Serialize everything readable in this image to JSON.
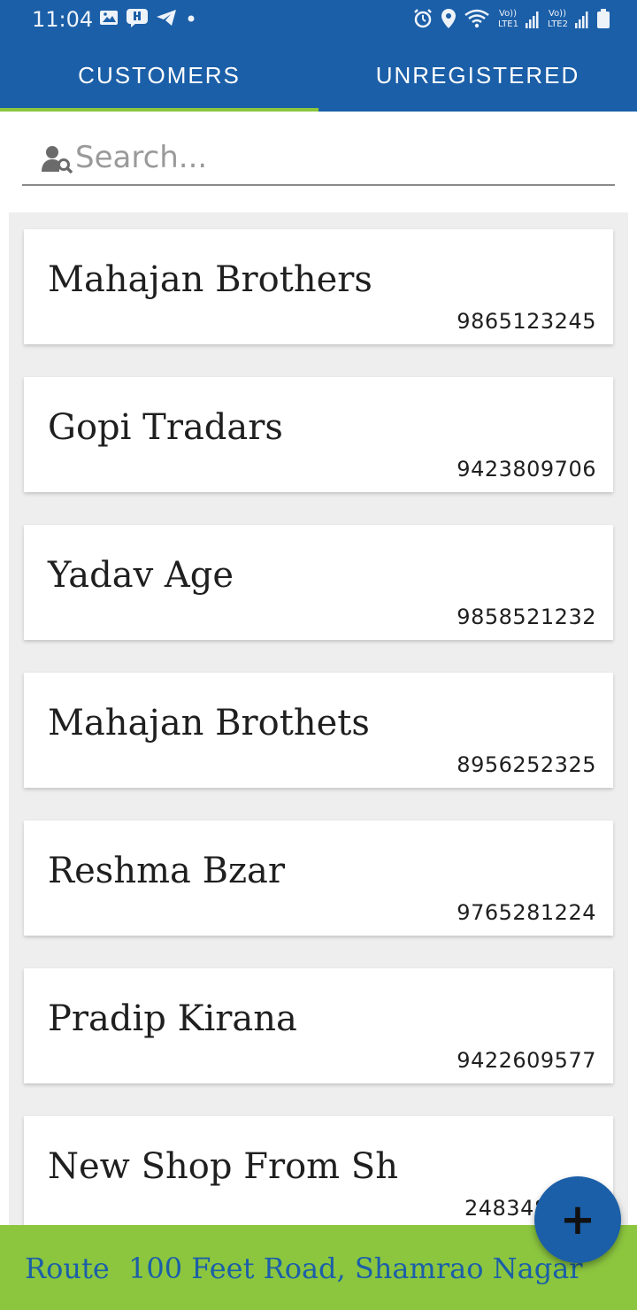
{
  "status_bar": {
    "time": "11:04",
    "left_icons": [
      "gallery-icon",
      "messaging-icon",
      "telegram-icon",
      "dot-icon"
    ],
    "right_icons": [
      "alarm-icon",
      "location-icon",
      "wifi-icon",
      "lte1-signal-icon",
      "lte2-signal-icon",
      "battery-icon"
    ],
    "lte1": "LTE1",
    "lte2": "LTE2",
    "volte": "Vo))"
  },
  "tabs": [
    {
      "label": "CUSTOMERS",
      "active": true
    },
    {
      "label": "UNREGISTERED",
      "active": false
    }
  ],
  "search": {
    "placeholder": "Search...",
    "value": "",
    "icon": "user-search-icon"
  },
  "customers": [
    {
      "name": "Mahajan Brothers",
      "phone": "9865123245"
    },
    {
      "name": "Gopi Tradars",
      "phone": "9423809706"
    },
    {
      "name": "Yadav Age",
      "phone": "9858521232"
    },
    {
      "name": "Mahajan Brothets",
      "phone": "8956252325"
    },
    {
      "name": "Reshma Bzar",
      "phone": "9765281224"
    },
    {
      "name": "Pradip Kirana",
      "phone": "9422609577"
    },
    {
      "name": "New Shop From Sh",
      "phone": "248348"
    }
  ],
  "fab": {
    "label": "+",
    "icon": "plus-icon"
  },
  "route": {
    "label": "Route",
    "value": "100 Feet Road, Shamrao Nagar"
  },
  "colors": {
    "primary": "#1b5fa8",
    "accent": "#8cc63f",
    "list_background": "#eeeeee"
  }
}
